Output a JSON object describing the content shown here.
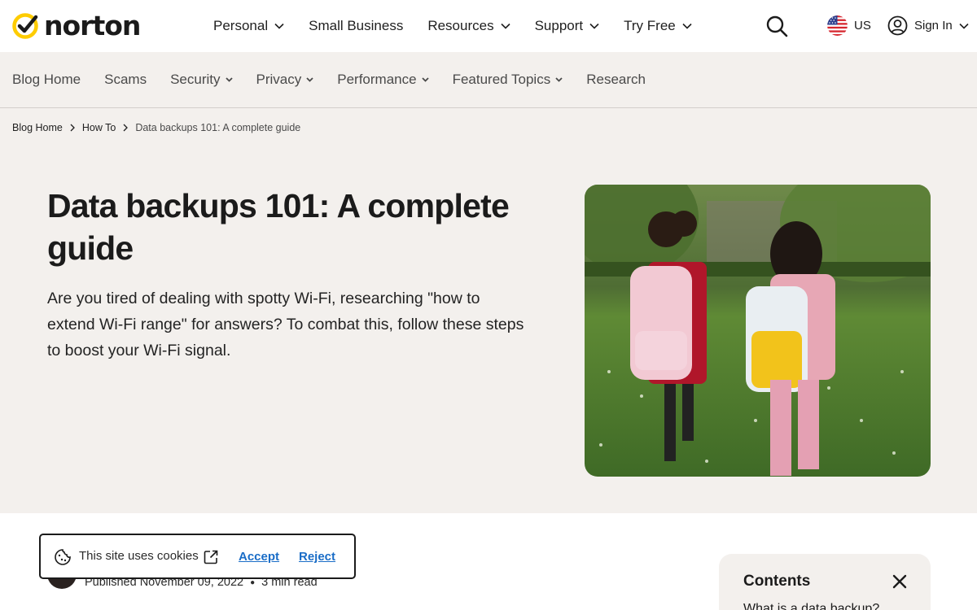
{
  "header": {
    "logo_text": "norton",
    "nav": [
      {
        "label": "Personal",
        "has_dropdown": true
      },
      {
        "label": "Small Business",
        "has_dropdown": false
      },
      {
        "label": "Resources",
        "has_dropdown": true
      },
      {
        "label": "Support",
        "has_dropdown": true
      },
      {
        "label": "Try Free",
        "has_dropdown": true
      }
    ],
    "region_label": "US",
    "signin_label": "Sign In"
  },
  "blog_nav": {
    "items": [
      {
        "label": "Blog Home",
        "has_dropdown": false
      },
      {
        "label": "Scams",
        "has_dropdown": false
      },
      {
        "label": "Security",
        "has_dropdown": true
      },
      {
        "label": "Privacy",
        "has_dropdown": true
      },
      {
        "label": "Performance",
        "has_dropdown": true
      },
      {
        "label": "Featured Topics",
        "has_dropdown": true
      },
      {
        "label": "Research",
        "has_dropdown": false
      }
    ]
  },
  "breadcrumb": {
    "items": [
      "Blog Home",
      "How To"
    ],
    "current": "Data backups 101: A complete guide"
  },
  "article": {
    "title": "Data backups 101: A complete guide",
    "description": "Are you tired of dealing with spotty Wi-Fi, researching \"how to extend Wi-Fi range\" for answers? To combat this, follow these steps to boost your Wi-Fi signal.",
    "hero_image": "two children with backpacks walking on grass",
    "published": "Published November 09, 2022",
    "read_time": "3 min read"
  },
  "contents": {
    "title": "Contents",
    "first_item": "What is a data backup?"
  },
  "cookie_banner": {
    "text": "This site uses cookies",
    "accept_label": "Accept",
    "reject_label": "Reject"
  },
  "colors": {
    "brand_yellow": "#fecc00",
    "link_blue": "#1a6dc7",
    "hero_bg": "#f3f0ed"
  }
}
